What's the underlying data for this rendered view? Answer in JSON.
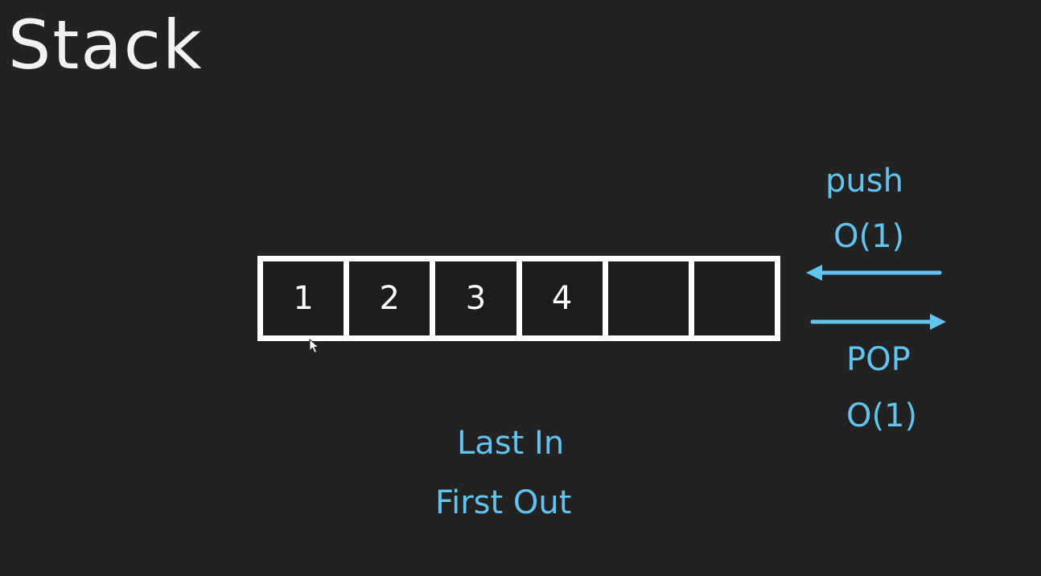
{
  "title": "Stack",
  "stack": {
    "cells": [
      "1",
      "2",
      "3",
      "4",
      "",
      ""
    ]
  },
  "push": {
    "label": "push",
    "complexity": "O(1)"
  },
  "pop": {
    "label": "POP",
    "complexity": "O(1)"
  },
  "principle": {
    "line1": "Last In",
    "line2": "First Out"
  },
  "colors": {
    "background": "#222222",
    "accent": "#62c3ee",
    "foreground": "#ffffff"
  },
  "icons": {
    "push_arrow": "arrow-left-icon",
    "pop_arrow": "arrow-right-icon",
    "cursor": "mouse-cursor-icon"
  }
}
